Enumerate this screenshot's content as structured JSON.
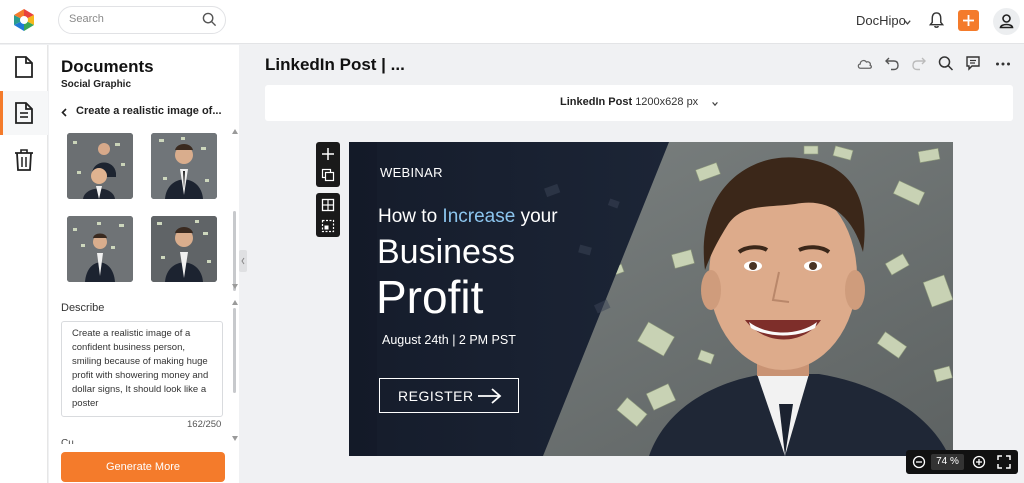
{
  "app": {
    "brand": "DocHipo",
    "search_placeholder": "Search"
  },
  "sidebar": {
    "title": "Documents",
    "subtitle": "Social Graphic",
    "back_label": "Create a realistic image of...",
    "describe_label": "Describe",
    "describe_text": "Create a realistic image of a confident business person, smiling because of making huge profit with showering money and dollar signs, It should look like a poster",
    "counter": "162/250",
    "cutoff_label": "Cu...",
    "generate_label": "Generate More"
  },
  "rail": {
    "items": [
      "document-icon",
      "document-lines-icon",
      "trash-icon"
    ]
  },
  "doc": {
    "title": "LinkedIn Post | ...",
    "size_name": "LinkedIn Post",
    "size_dims": "1200x628 px"
  },
  "poster": {
    "eyebrow": "WEBINAR",
    "line1_pre": "How to ",
    "line1_hl": "Increase",
    "line1_post": " your",
    "line2": "Business",
    "line3": "Profit",
    "date": "August 24th | 2 PM PST",
    "cta": "REGISTER"
  },
  "zoom": {
    "value": "74 %"
  },
  "colors": {
    "accent": "#f47b2b",
    "poster_bg": "#181f2e",
    "highlight": "#8cc5ee"
  }
}
